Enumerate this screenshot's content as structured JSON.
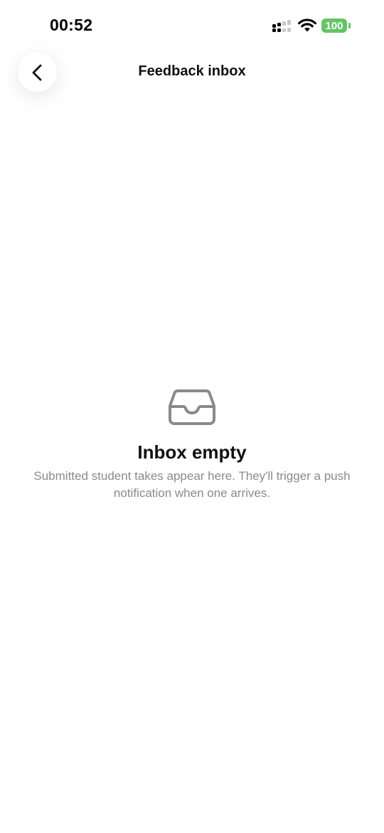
{
  "status_bar": {
    "time": "00:52",
    "battery": "100",
    "icons": [
      "cellular-signal-icon",
      "wifi-icon",
      "battery-icon"
    ]
  },
  "header": {
    "title": "Feedback inbox",
    "back_icon": "chevron-left-icon"
  },
  "empty_state": {
    "icon": "inbox-tray-icon",
    "title": "Inbox empty",
    "message": "Submitted student takes appear here. They'll trigger a push notification when one arrives."
  },
  "colors": {
    "battery_green": "#65c466",
    "title_text": "#111111",
    "secondary_text": "#8a8a8a",
    "icon_gray": "#8a8a8a",
    "background": "#ffffff"
  }
}
